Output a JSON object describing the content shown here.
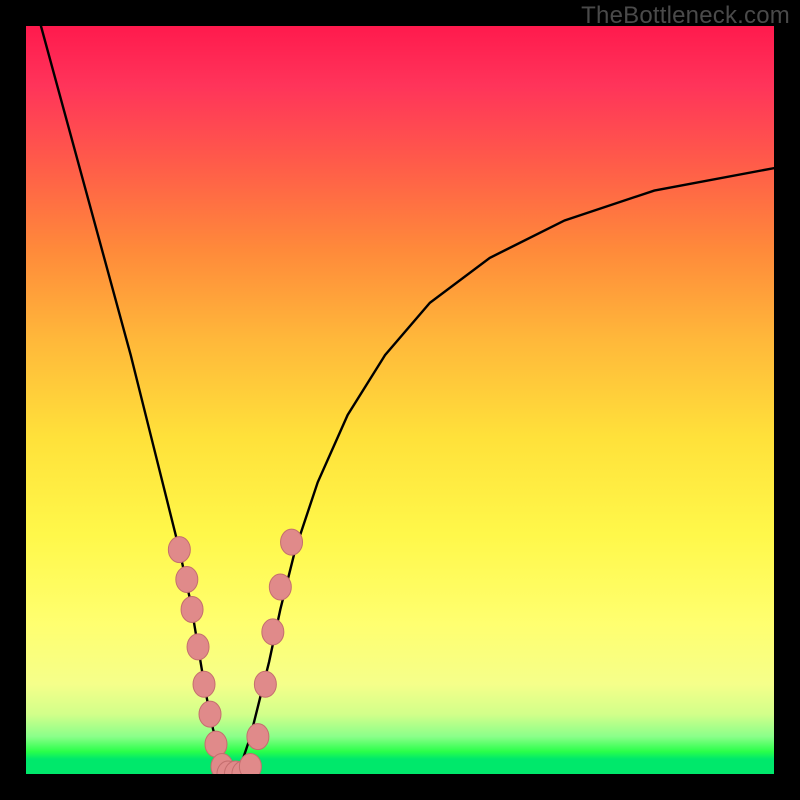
{
  "watermark": "TheBottleneck.com",
  "colors": {
    "background": "#000000",
    "gradient_top": "#ff1a4d",
    "gradient_mid": "#ffe13a",
    "gradient_bottom": "#00e86b",
    "curve": "#000000",
    "marker_fill": "#e08a8a",
    "marker_stroke": "#c46e6e"
  },
  "chart_data": {
    "type": "line",
    "title": "",
    "xlabel": "",
    "ylabel": "",
    "xlim": [
      0,
      100
    ],
    "ylim": [
      0,
      100
    ],
    "grid": false,
    "legend": false,
    "notes": "Two black curves descending into a narrow V shape near x≈25 reaching y≈0, right curve rises asymptotically; salmon oval markers cluster along both curves near the bottom of the V.",
    "series": [
      {
        "name": "left_curve",
        "x": [
          2,
          5,
          8,
          11,
          14,
          17,
          19,
          20.5,
          22,
          23,
          24,
          25,
          26,
          27,
          28
        ],
        "y": [
          100,
          89,
          78,
          67,
          56,
          44,
          36,
          30,
          23,
          17,
          11,
          6,
          3,
          1,
          0
        ]
      },
      {
        "name": "right_curve",
        "x": [
          28,
          29,
          30,
          31,
          32.5,
          34,
          36,
          39,
          43,
          48,
          54,
          62,
          72,
          84,
          100
        ],
        "y": [
          0,
          2,
          5,
          9,
          15,
          22,
          30,
          39,
          48,
          56,
          63,
          69,
          74,
          78,
          81
        ]
      }
    ],
    "markers": {
      "name": "highlighted_points",
      "shape": "ellipse",
      "points": [
        {
          "x": 20.5,
          "y": 30
        },
        {
          "x": 21.5,
          "y": 26
        },
        {
          "x": 22.2,
          "y": 22
        },
        {
          "x": 23.0,
          "y": 17
        },
        {
          "x": 23.8,
          "y": 12
        },
        {
          "x": 24.6,
          "y": 8
        },
        {
          "x": 25.4,
          "y": 4
        },
        {
          "x": 26.2,
          "y": 1
        },
        {
          "x": 27.0,
          "y": 0
        },
        {
          "x": 28.0,
          "y": 0
        },
        {
          "x": 29.0,
          "y": 0
        },
        {
          "x": 30.0,
          "y": 1
        },
        {
          "x": 31.0,
          "y": 5
        },
        {
          "x": 32.0,
          "y": 12
        },
        {
          "x": 33.0,
          "y": 19
        },
        {
          "x": 34.0,
          "y": 25
        },
        {
          "x": 35.5,
          "y": 31
        }
      ]
    }
  }
}
